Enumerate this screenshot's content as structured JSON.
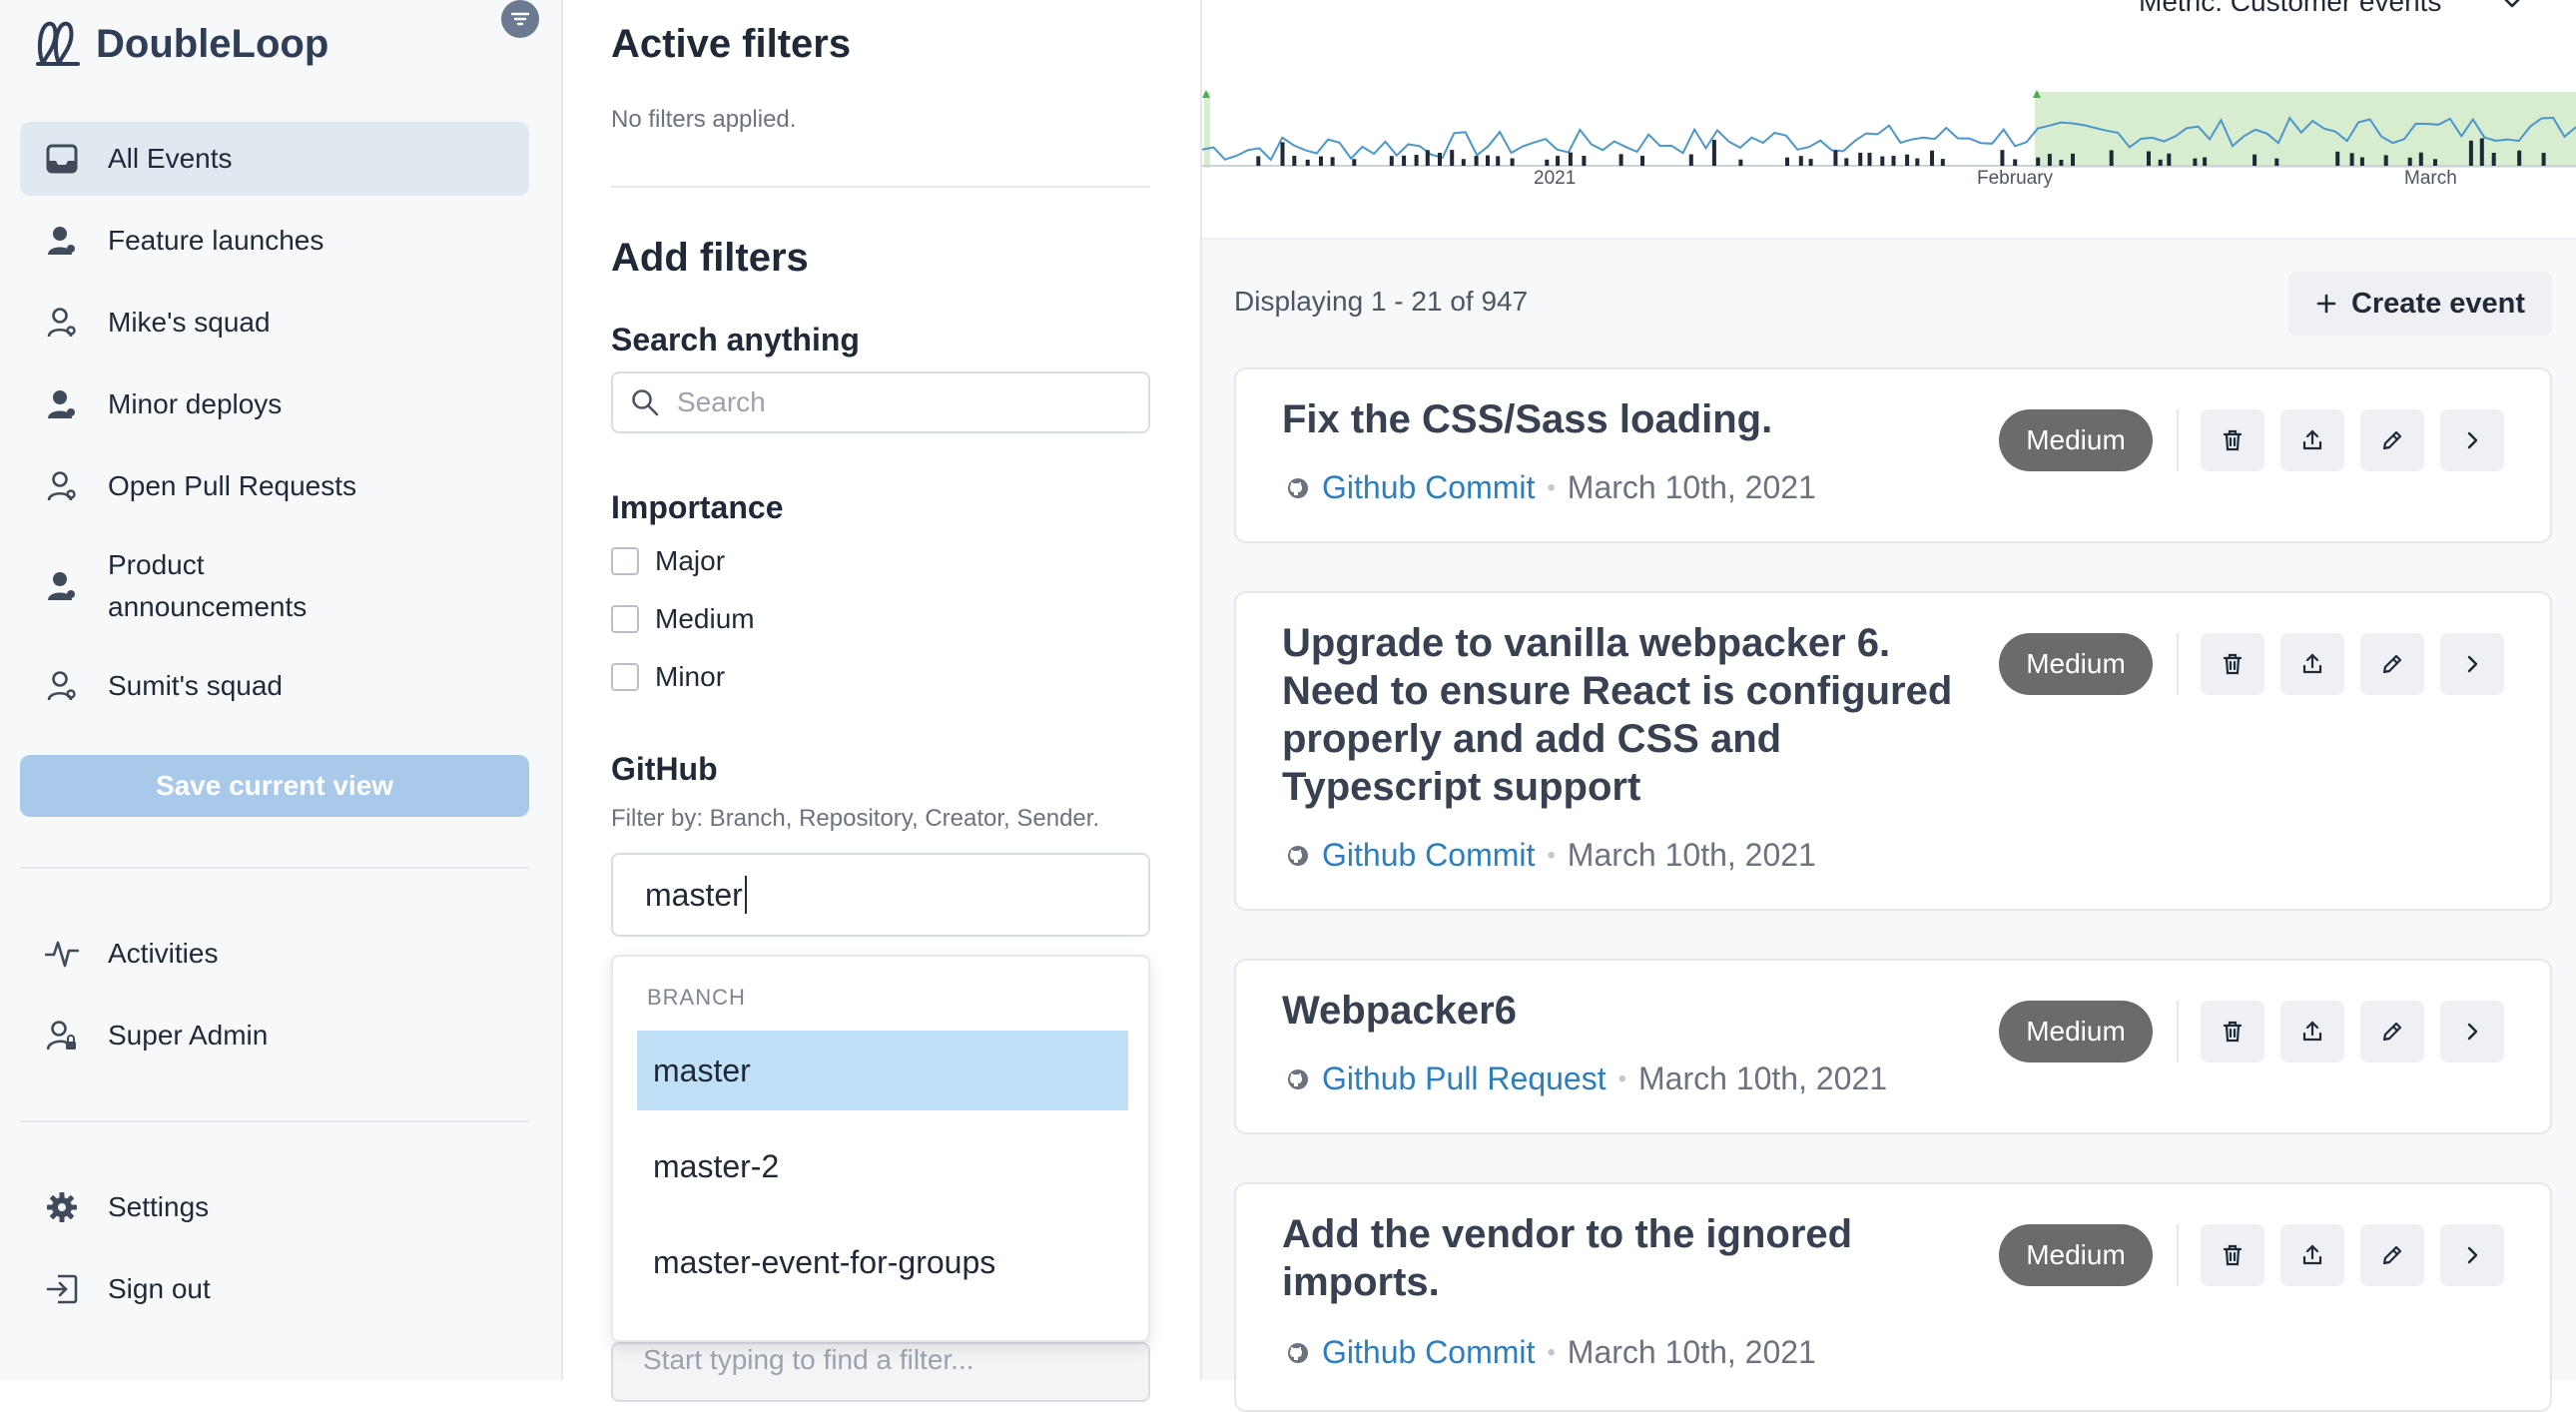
{
  "app": {
    "name": "DoubleLoop"
  },
  "sidebar": {
    "items": [
      {
        "label": "All Events",
        "icon": "inbox-icon",
        "active": true
      },
      {
        "label": "Feature launches",
        "icon": "user-filled-icon"
      },
      {
        "label": "Mike's squad",
        "icon": "user-outline-icon"
      },
      {
        "label": "Minor deploys",
        "icon": "user-filled-icon"
      },
      {
        "label": "Open Pull Requests",
        "icon": "user-outline-icon"
      },
      {
        "label": "Product announcements",
        "icon": "user-filled-icon"
      },
      {
        "label": "Sumit's squad",
        "icon": "user-outline-icon"
      }
    ],
    "save_view_label": "Save current view",
    "secondary": [
      {
        "label": "Activities",
        "icon": "activity-icon"
      },
      {
        "label": "Super Admin",
        "icon": "user-lock-icon"
      }
    ],
    "footer": [
      {
        "label": "Settings",
        "icon": "gear-icon"
      },
      {
        "label": "Sign out",
        "icon": "sign-out-icon"
      }
    ]
  },
  "filters": {
    "active_title": "Active filters",
    "active_empty": "No filters applied.",
    "add_title": "Add filters",
    "search": {
      "label": "Search anything",
      "placeholder": "Search"
    },
    "importance": {
      "label": "Importance",
      "options": [
        "Major",
        "Medium",
        "Minor"
      ]
    },
    "github": {
      "label": "GitHub",
      "help": "Filter by: Branch, Repository, Creator, Sender.",
      "value": "master",
      "dropdown": {
        "group": "BRANCH",
        "options": [
          "master",
          "master-2",
          "master-event-for-groups"
        ],
        "highlighted": "master"
      }
    },
    "next_input_placeholder": "Start typing to find a filter..."
  },
  "main": {
    "metric_label": "Metric: Customer events",
    "chart": {
      "ticks": [
        "2021",
        "February",
        "March"
      ]
    },
    "displaying": "Displaying 1 - 21 of 947",
    "create_event_label": "Create event",
    "events": [
      {
        "title": "Fix the CSS/Sass loading.",
        "source": "Github Commit",
        "date": "March 10th, 2021",
        "importance": "Medium"
      },
      {
        "title": "Upgrade to vanilla webpacker 6. Need to ensure React is configured properly and add CSS and Typescript support",
        "source": "Github Commit",
        "date": "March 10th, 2021",
        "importance": "Medium"
      },
      {
        "title": "Webpacker6",
        "source": "Github Pull Request",
        "date": "March 10th, 2021",
        "importance": "Medium"
      },
      {
        "title": "Add the vendor to the ignored imports.",
        "source": "Github Commit",
        "date": "March 10th, 2021",
        "importance": "Medium"
      }
    ]
  },
  "colors": {
    "accent": "#2b7ec1",
    "badge": "#6b6b6b",
    "highlight": "#bfe0f6",
    "save_view": "#a9c9eb"
  }
}
